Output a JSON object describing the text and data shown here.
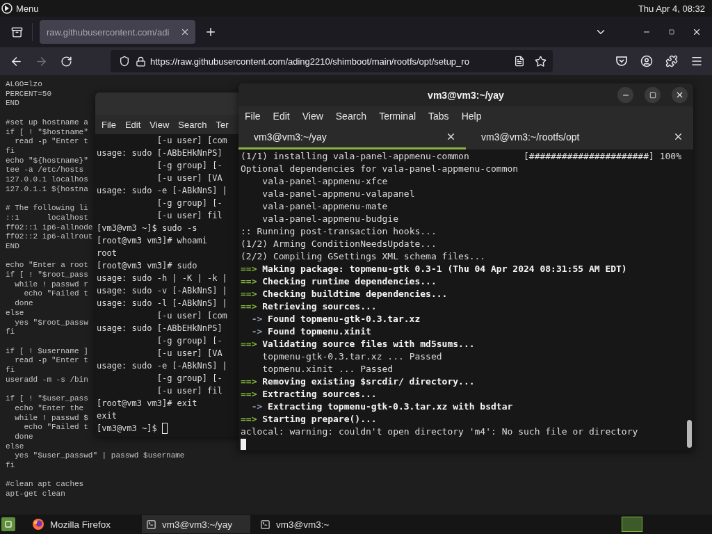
{
  "top_panel": {
    "menu_label": "Menu",
    "clock": "Thu Apr 4, 08:32"
  },
  "firefox": {
    "tabs": [
      {
        "title": "raw.githubusercontent.com/adi",
        "selected": true
      }
    ],
    "navigation": {
      "forward_disabled": true
    },
    "url": "https://raw.githubusercontent.com/ading2210/shimboot/main/rootfs/opt/setup_ro",
    "content_blocks": [
      [
        "ALGO=lzo",
        "PERCENT=50",
        "END"
      ],
      [
        "#set up hostname a",
        "if [ ! \"$hostname\"",
        "  read -p \"Enter t",
        "fi",
        "echo \"${hostname}\"",
        "tee -a /etc/hosts",
        "127.0.0.1 localhos",
        "127.0.1.1 ${hostna"
      ],
      [
        "# The following li",
        "::1      localhost",
        "ff02::1 ip6-allnode",
        "ff02::2 ip6-allrout",
        "END"
      ],
      [
        "echo \"Enter a root",
        "if [ ! \"$root_pass",
        "  while ! passwd r",
        "    echo \"Failed t",
        "  done",
        "else",
        "  yes \"$root_passw",
        "fi"
      ],
      [
        "if [ ! $username ]",
        "  read -p \"Enter t",
        "fi",
        "useradd -m -s /bin"
      ],
      [
        "if [ ! \"$user_pass",
        "  echo \"Enter the",
        "  while ! passwd $",
        "    echo \"Failed t",
        "  done",
        "else",
        "  yes \"$user_passwd\" | passwd $username",
        "fi"
      ],
      [
        "#clean apt caches",
        "apt-get clean"
      ]
    ]
  },
  "back_terminal": {
    "menu": [
      "File",
      "Edit",
      "View",
      "Search",
      "Ter"
    ],
    "lines": [
      "            [-u user] [com",
      "usage: sudo [-ABbEHkNnPS]",
      "            [-g group] [-",
      "            [-u user] [VA",
      "usage: sudo -e [-ABkNnS] |",
      "            [-g group] [-",
      "            [-u user] fil",
      "[vm3@vm3 ~]$ sudo -s",
      "[root@vm3 vm3]# whoami",
      "root",
      "[root@vm3 vm3]# sudo",
      "usage: sudo -h | -K | -k |",
      "usage: sudo -v [-ABkNnS] |",
      "usage: sudo -l [-ABkNnS] |",
      "            [-u user] [com",
      "usage: sudo [-ABbEHkNnPS]",
      "            [-g group] [-",
      "            [-u user] [VA",
      "usage: sudo -e [-ABkNnS] |",
      "            [-g group] [-",
      "            [-u user] fil",
      "[root@vm3 vm3]# exit",
      "exit",
      "[vm3@vm3 ~]$"
    ]
  },
  "front_terminal": {
    "title": "vm3@vm3:~/yay",
    "menu": [
      "File",
      "Edit",
      "View",
      "Search",
      "Terminal",
      "Tabs",
      "Help"
    ],
    "tabs": [
      {
        "title": "vm3@vm3:~/yay",
        "selected": true
      },
      {
        "title": "vm3@vm3:~/rootfs/opt",
        "selected": false
      }
    ],
    "lines": [
      {
        "kind": "plain",
        "text": "(1/1) installing vala-panel-appmenu-common          [######################] 100%"
      },
      {
        "kind": "plain",
        "text": "Optional dependencies for vala-panel-appmenu-common"
      },
      {
        "kind": "plain",
        "text": "    vala-panel-appmenu-xfce"
      },
      {
        "kind": "plain",
        "text": "    vala-panel-appmenu-valapanel"
      },
      {
        "kind": "plain",
        "text": "    vala-panel-appmenu-mate"
      },
      {
        "kind": "plain",
        "text": "    vala-panel-appmenu-budgie"
      },
      {
        "kind": "plain",
        "text": ":: Running post-transaction hooks..."
      },
      {
        "kind": "plain",
        "text": "(1/2) Arming ConditionNeedsUpdate..."
      },
      {
        "kind": "plain",
        "text": "(2/2) Compiling GSettings XML schema files..."
      },
      {
        "kind": "step",
        "marker": "==>",
        "text": "Making package: topmenu-gtk 0.3-1 (Thu 04 Apr 2024 08:31:55 AM EDT)"
      },
      {
        "kind": "step",
        "marker": "==>",
        "text": "Checking runtime dependencies..."
      },
      {
        "kind": "step",
        "marker": "==>",
        "text": "Checking buildtime dependencies..."
      },
      {
        "kind": "step",
        "marker": "==>",
        "text": "Retrieving sources..."
      },
      {
        "kind": "sub",
        "marker": "->",
        "text": "Found topmenu-gtk-0.3.tar.xz"
      },
      {
        "kind": "sub",
        "marker": "->",
        "text": "Found topmenu.xinit"
      },
      {
        "kind": "step",
        "marker": "==>",
        "text": "Validating source files with md5sums..."
      },
      {
        "kind": "plain",
        "text": "    topmenu-gtk-0.3.tar.xz ... Passed"
      },
      {
        "kind": "plain",
        "text": "    topmenu.xinit ... Passed"
      },
      {
        "kind": "step",
        "marker": "==>",
        "text": "Removing existing $srcdir/ directory..."
      },
      {
        "kind": "step",
        "marker": "==>",
        "text": "Extracting sources..."
      },
      {
        "kind": "sub",
        "marker": "->",
        "text": "Extracting topmenu-gtk-0.3.tar.xz with bsdtar"
      },
      {
        "kind": "step",
        "marker": "==>",
        "text": "Starting prepare()..."
      },
      {
        "kind": "plain",
        "text": "aclocal: warning: couldn't open directory 'm4': No such file or directory"
      }
    ]
  },
  "taskbar": {
    "items": [
      {
        "kind": "browser",
        "label": "Mozilla Firefox",
        "selected": false
      },
      {
        "kind": "terminal",
        "label": "vm3@vm3:~/yay",
        "selected": true
      },
      {
        "kind": "terminal",
        "label": "vm3@vm3:~",
        "selected": false
      }
    ]
  }
}
